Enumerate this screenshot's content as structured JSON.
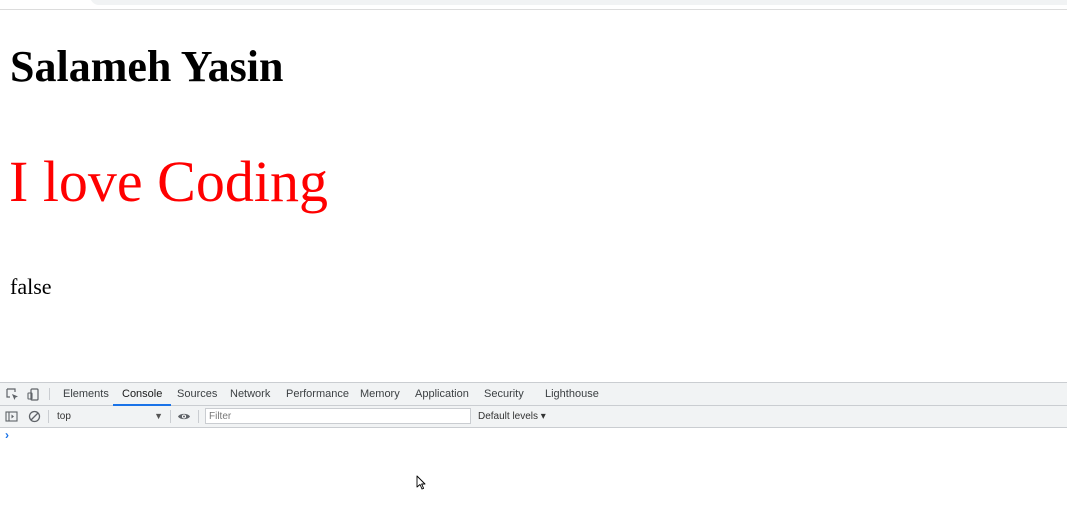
{
  "page": {
    "heading": "Salameh Yasin",
    "highlight_text": "I love Coding",
    "highlight_color": "#ff0000",
    "result_text": "false"
  },
  "devtools": {
    "tabs": [
      {
        "label": "Elements"
      },
      {
        "label": "Console",
        "active": true
      },
      {
        "label": "Sources"
      },
      {
        "label": "Network"
      },
      {
        "label": "Performance"
      },
      {
        "label": "Memory"
      },
      {
        "label": "Application"
      },
      {
        "label": "Security"
      },
      {
        "label": "Lighthouse"
      }
    ],
    "toolbar": {
      "context": "top",
      "filter_placeholder": "Filter",
      "levels": "Default levels ▾"
    },
    "prompt_symbol": "›",
    "accent_color": "#1a73e8"
  },
  "icons": {
    "inspect": "inspect-element-icon",
    "device": "device-toolbar-icon",
    "sidebar": "console-sidebar-icon",
    "clear": "clear-console-icon",
    "eye": "live-expression-eye-icon",
    "cursor": "mouse-pointer-icon"
  }
}
